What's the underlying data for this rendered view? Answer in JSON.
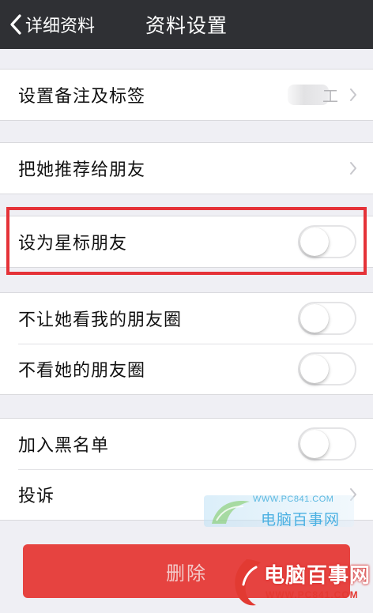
{
  "navbar": {
    "back_label": "详细资料",
    "title": "资料设置"
  },
  "sections": {
    "remark": {
      "label": "设置备注及标签",
      "value_tail": "工"
    },
    "recommend": {
      "label": "把她推荐给朋友"
    },
    "star": {
      "label": "设为星标朋友",
      "on": false
    },
    "privacy": [
      {
        "label": "不让她看我的朋友圈",
        "on": false
      },
      {
        "label": "不看她的朋友圈",
        "on": false
      }
    ],
    "blacklist": {
      "label": "加入黑名单",
      "on": false
    },
    "complain": {
      "label": "投诉"
    }
  },
  "delete_button": "删除",
  "watermarks": {
    "top": {
      "url": "WWW.PC841.COM",
      "name": "电脑百事网"
    },
    "bottom": {
      "name": "电脑百事网",
      "url": "WWW.PC841.COM"
    }
  },
  "colors": {
    "navbar": "#2f3034",
    "background": "#efeff4",
    "delete": "#e64340",
    "highlight": "#e53238"
  }
}
